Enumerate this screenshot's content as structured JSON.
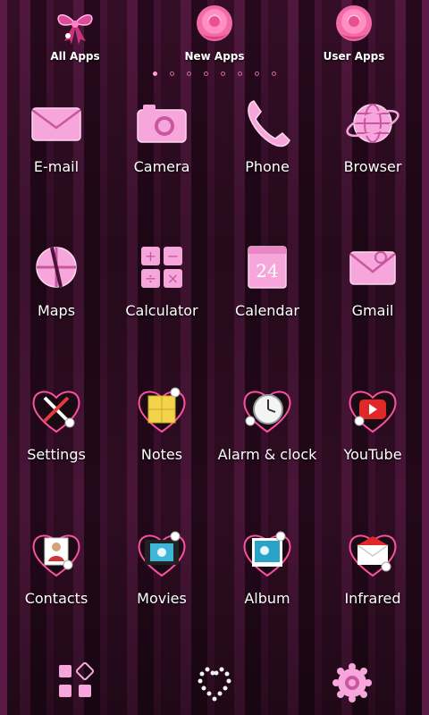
{
  "top_bar": {
    "items": [
      {
        "label": "All Apps",
        "icon": "ribbon-bow-icon"
      },
      {
        "label": "New Apps",
        "icon": "rose-icon"
      },
      {
        "label": "User Apps",
        "icon": "rose-icon"
      }
    ]
  },
  "page_indicator": {
    "count": 8,
    "active_index": 0
  },
  "apps": [
    {
      "label": "E-mail",
      "icon": "envelope-icon"
    },
    {
      "label": "Camera",
      "icon": "camera-icon"
    },
    {
      "label": "Phone",
      "icon": "phone-handset-icon"
    },
    {
      "label": "Browser",
      "icon": "globe-icon"
    },
    {
      "label": "Maps",
      "icon": "map-pin-icon"
    },
    {
      "label": "Calculator",
      "icon": "calculator-icon"
    },
    {
      "label": "Calendar",
      "icon": "calendar-icon"
    },
    {
      "label": "Gmail",
      "icon": "gmail-envelope-icon"
    },
    {
      "label": "Settings",
      "icon": "settings-tools-icon"
    },
    {
      "label": "Notes",
      "icon": "notes-icon"
    },
    {
      "label": "Alarm & clock",
      "icon": "clock-icon"
    },
    {
      "label": "YouTube",
      "icon": "youtube-icon"
    },
    {
      "label": "Contacts",
      "icon": "contacts-icon"
    },
    {
      "label": "Movies",
      "icon": "film-icon"
    },
    {
      "label": "Album",
      "icon": "photo-icon"
    },
    {
      "label": "Infrared",
      "icon": "infrared-envelope-icon"
    }
  ],
  "calendar_icon_number": "24",
  "dock": {
    "items": [
      {
        "icon": "app-drawer-grid-icon"
      },
      {
        "icon": "heart-beads-icon"
      },
      {
        "icon": "settings-gear-icon"
      }
    ]
  },
  "colors": {
    "icon_pink": "#f7a6dc",
    "background_dark": "#2a0a1f",
    "stripe": "#5a1a45",
    "text": "#ffffff"
  }
}
